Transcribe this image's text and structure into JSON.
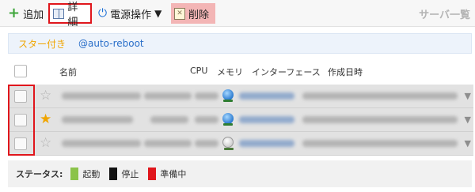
{
  "toolbar": {
    "add_label": "追加",
    "detail_label": "詳細",
    "power_label": "電源操作",
    "delete_label": "削除",
    "section_title": "サーバ一覧"
  },
  "filters": {
    "starred": "スター付き",
    "tag": "@auto-reboot",
    "starred_color": "#f0a500",
    "tag_color": "#2a6fc9"
  },
  "table": {
    "columns": [
      "名前",
      "CPU",
      "メモリ",
      "インターフェース",
      "作成日時"
    ],
    "rows": [
      {
        "starred": false,
        "interface_online": true
      },
      {
        "starred": true,
        "interface_online": true
      },
      {
        "starred": false,
        "interface_online": false
      }
    ]
  },
  "legend": {
    "label": "ステータス:",
    "items": [
      {
        "label": "起動",
        "color": "#8bc34a"
      },
      {
        "label": "停止",
        "color": "#111111"
      },
      {
        "label": "準備中",
        "color": "#e0161c"
      }
    ]
  }
}
